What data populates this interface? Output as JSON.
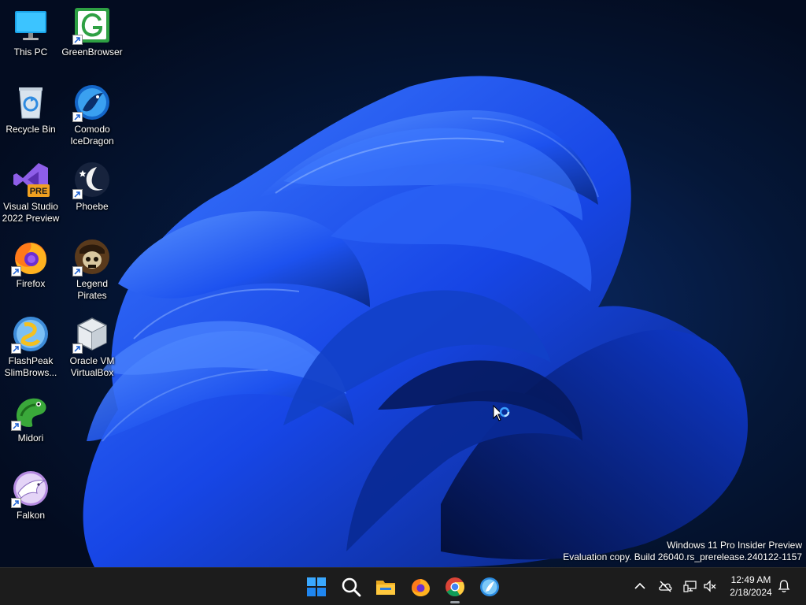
{
  "desktop": {
    "icons": [
      {
        "label": "This PC"
      },
      {
        "label": "GreenBrowser"
      },
      {
        "label": "Recycle Bin"
      },
      {
        "label": "Comodo IceDragon"
      },
      {
        "label": "Visual Studio 2022 Preview",
        "badge": "PRE"
      },
      {
        "label": "Phoebe"
      },
      {
        "label": "Firefox"
      },
      {
        "label": "Legend Pirates"
      },
      {
        "label": "FlashPeak SlimBrows..."
      },
      {
        "label": "Oracle VM VirtualBox"
      },
      {
        "label": "Midori"
      },
      {
        "label": "Falkon"
      }
    ]
  },
  "watermark": {
    "line1": "Windows 11 Pro Insider Preview",
    "line2": "Evaluation copy. Build 26040.rs_prerelease.240122-1157"
  },
  "taskbar": {
    "pinned": [
      {
        "icon": "windows-start-icon"
      },
      {
        "icon": "search-icon"
      },
      {
        "icon": "file-explorer-icon"
      },
      {
        "icon": "firefox-icon"
      },
      {
        "icon": "chrome-icon",
        "active": true
      },
      {
        "icon": "slimbrowser-icon"
      }
    ],
    "tray": [
      {
        "icon": "chevron-up-icon"
      },
      {
        "icon": "onedrive-offline-icon"
      },
      {
        "icon": "network-icon"
      },
      {
        "icon": "volume-muted-icon"
      },
      {
        "icon": "notification-bell-icon"
      }
    ],
    "clock": {
      "time": "12:49 AM",
      "date": "2/18/2024"
    }
  },
  "colors": {
    "accent": "#1a4dff",
    "taskbar": "#1c1c1c",
    "wallpaper_dark": "#030c20"
  }
}
